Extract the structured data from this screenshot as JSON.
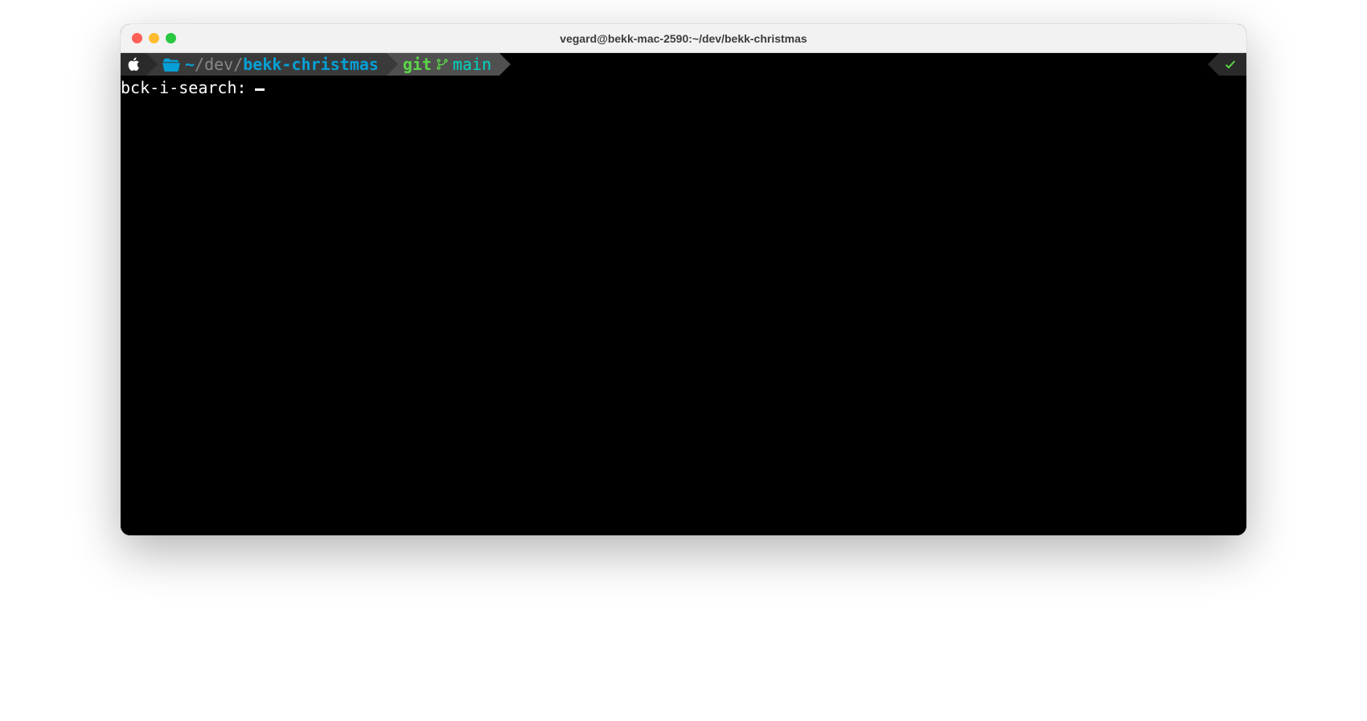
{
  "window": {
    "title": "vegard@bekk-mac-2590:~/dev/bekk-christmas"
  },
  "prompt": {
    "path": {
      "tilde": "~",
      "sep1": "/",
      "dev": "dev",
      "sep2": "/",
      "current": "bekk-christmas"
    },
    "git": {
      "label": "git",
      "branch": "main"
    }
  },
  "search": {
    "label": "bck-i-search: "
  }
}
